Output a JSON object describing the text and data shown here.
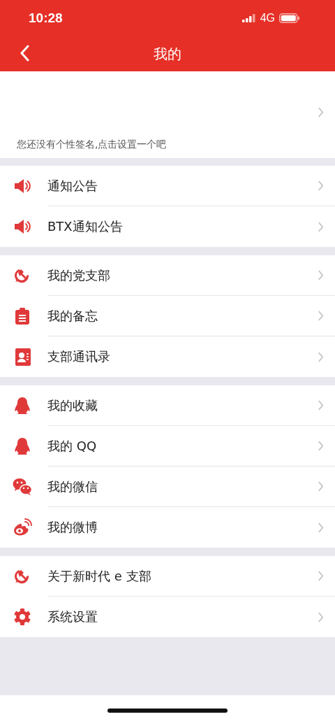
{
  "status_bar": {
    "time": "10:28",
    "network": "4G"
  },
  "nav_bar": {
    "title": "我的"
  },
  "profile": {
    "signature": "您还没有个性签名,点击设置一个吧"
  },
  "groups": [
    {
      "items": [
        {
          "label": "通知公告",
          "kind": "speaker"
        },
        {
          "label": "BTX通知公告",
          "kind": "speaker"
        }
      ]
    },
    {
      "items": [
        {
          "label": "我的党支部",
          "kind": "emblem"
        },
        {
          "label": "我的备忘",
          "kind": "clipboard"
        },
        {
          "label": "支部通讯录",
          "kind": "contact"
        }
      ]
    },
    {
      "items": [
        {
          "label": "我的收藏",
          "kind": "penguin"
        },
        {
          "label": "我的 QQ",
          "kind": "penguin"
        },
        {
          "label": "我的微信",
          "kind": "chat"
        },
        {
          "label": "我的微博",
          "kind": "swirl"
        }
      ]
    },
    {
      "items": [
        {
          "label": "关于新时代 e 支部",
          "kind": "emblem"
        },
        {
          "label": "系统设置",
          "kind": "gear"
        }
      ]
    }
  ]
}
